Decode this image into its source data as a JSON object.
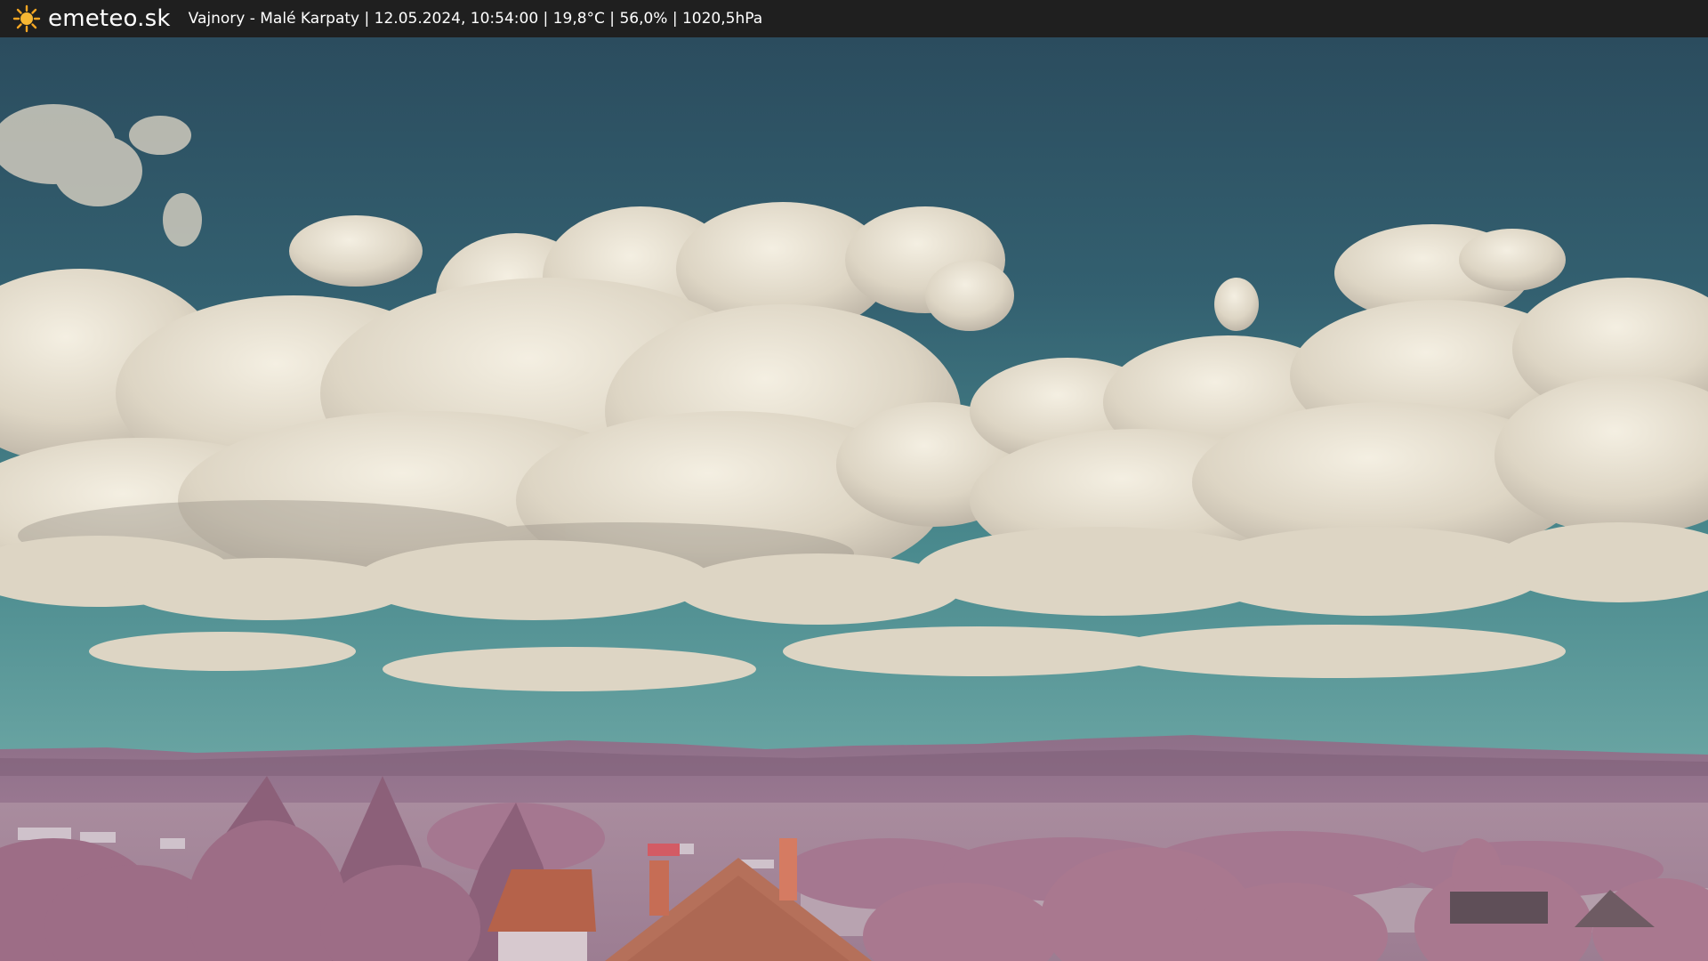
{
  "header": {
    "logo_icon": "sun-icon",
    "brand": "emeteo.sk",
    "caption": "Vajnory - Malé Karpaty | 12.05.2024, 10:54:00 | 19,8°C | 56,0% | 1020,5hPa"
  },
  "colors": {
    "bar": "#1f1f1f",
    "sky_top": "#2d4f60",
    "sky_low": "#4f8e90",
    "cloud": "#e9e3d4",
    "hills": "#9c7a94",
    "foliage": "#a9788f",
    "roof": "#b5624a",
    "sun": "#f5a623"
  }
}
